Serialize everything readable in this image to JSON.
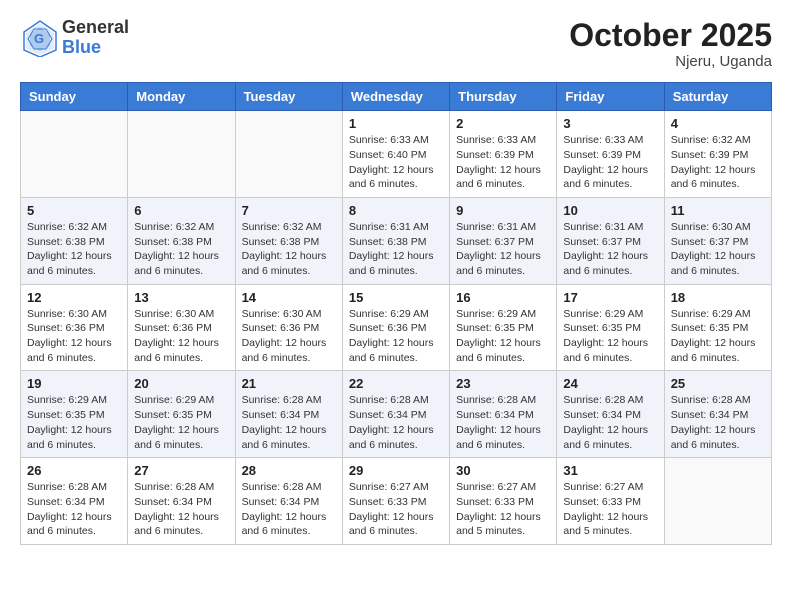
{
  "header": {
    "logo_general": "General",
    "logo_blue": "Blue",
    "month": "October 2025",
    "location": "Njeru, Uganda"
  },
  "days_of_week": [
    "Sunday",
    "Monday",
    "Tuesday",
    "Wednesday",
    "Thursday",
    "Friday",
    "Saturday"
  ],
  "weeks": [
    [
      {
        "day": "",
        "info": ""
      },
      {
        "day": "",
        "info": ""
      },
      {
        "day": "",
        "info": ""
      },
      {
        "day": "1",
        "info": "Sunrise: 6:33 AM\nSunset: 6:40 PM\nDaylight: 12 hours\nand 6 minutes."
      },
      {
        "day": "2",
        "info": "Sunrise: 6:33 AM\nSunset: 6:39 PM\nDaylight: 12 hours\nand 6 minutes."
      },
      {
        "day": "3",
        "info": "Sunrise: 6:33 AM\nSunset: 6:39 PM\nDaylight: 12 hours\nand 6 minutes."
      },
      {
        "day": "4",
        "info": "Sunrise: 6:32 AM\nSunset: 6:39 PM\nDaylight: 12 hours\nand 6 minutes."
      }
    ],
    [
      {
        "day": "5",
        "info": "Sunrise: 6:32 AM\nSunset: 6:38 PM\nDaylight: 12 hours\nand 6 minutes."
      },
      {
        "day": "6",
        "info": "Sunrise: 6:32 AM\nSunset: 6:38 PM\nDaylight: 12 hours\nand 6 minutes."
      },
      {
        "day": "7",
        "info": "Sunrise: 6:32 AM\nSunset: 6:38 PM\nDaylight: 12 hours\nand 6 minutes."
      },
      {
        "day": "8",
        "info": "Sunrise: 6:31 AM\nSunset: 6:38 PM\nDaylight: 12 hours\nand 6 minutes."
      },
      {
        "day": "9",
        "info": "Sunrise: 6:31 AM\nSunset: 6:37 PM\nDaylight: 12 hours\nand 6 minutes."
      },
      {
        "day": "10",
        "info": "Sunrise: 6:31 AM\nSunset: 6:37 PM\nDaylight: 12 hours\nand 6 minutes."
      },
      {
        "day": "11",
        "info": "Sunrise: 6:30 AM\nSunset: 6:37 PM\nDaylight: 12 hours\nand 6 minutes."
      }
    ],
    [
      {
        "day": "12",
        "info": "Sunrise: 6:30 AM\nSunset: 6:36 PM\nDaylight: 12 hours\nand 6 minutes."
      },
      {
        "day": "13",
        "info": "Sunrise: 6:30 AM\nSunset: 6:36 PM\nDaylight: 12 hours\nand 6 minutes."
      },
      {
        "day": "14",
        "info": "Sunrise: 6:30 AM\nSunset: 6:36 PM\nDaylight: 12 hours\nand 6 minutes."
      },
      {
        "day": "15",
        "info": "Sunrise: 6:29 AM\nSunset: 6:36 PM\nDaylight: 12 hours\nand 6 minutes."
      },
      {
        "day": "16",
        "info": "Sunrise: 6:29 AM\nSunset: 6:35 PM\nDaylight: 12 hours\nand 6 minutes."
      },
      {
        "day": "17",
        "info": "Sunrise: 6:29 AM\nSunset: 6:35 PM\nDaylight: 12 hours\nand 6 minutes."
      },
      {
        "day": "18",
        "info": "Sunrise: 6:29 AM\nSunset: 6:35 PM\nDaylight: 12 hours\nand 6 minutes."
      }
    ],
    [
      {
        "day": "19",
        "info": "Sunrise: 6:29 AM\nSunset: 6:35 PM\nDaylight: 12 hours\nand 6 minutes."
      },
      {
        "day": "20",
        "info": "Sunrise: 6:29 AM\nSunset: 6:35 PM\nDaylight: 12 hours\nand 6 minutes."
      },
      {
        "day": "21",
        "info": "Sunrise: 6:28 AM\nSunset: 6:34 PM\nDaylight: 12 hours\nand 6 minutes."
      },
      {
        "day": "22",
        "info": "Sunrise: 6:28 AM\nSunset: 6:34 PM\nDaylight: 12 hours\nand 6 minutes."
      },
      {
        "day": "23",
        "info": "Sunrise: 6:28 AM\nSunset: 6:34 PM\nDaylight: 12 hours\nand 6 minutes."
      },
      {
        "day": "24",
        "info": "Sunrise: 6:28 AM\nSunset: 6:34 PM\nDaylight: 12 hours\nand 6 minutes."
      },
      {
        "day": "25",
        "info": "Sunrise: 6:28 AM\nSunset: 6:34 PM\nDaylight: 12 hours\nand 6 minutes."
      }
    ],
    [
      {
        "day": "26",
        "info": "Sunrise: 6:28 AM\nSunset: 6:34 PM\nDaylight: 12 hours\nand 6 minutes."
      },
      {
        "day": "27",
        "info": "Sunrise: 6:28 AM\nSunset: 6:34 PM\nDaylight: 12 hours\nand 6 minutes."
      },
      {
        "day": "28",
        "info": "Sunrise: 6:28 AM\nSunset: 6:34 PM\nDaylight: 12 hours\nand 6 minutes."
      },
      {
        "day": "29",
        "info": "Sunrise: 6:27 AM\nSunset: 6:33 PM\nDaylight: 12 hours\nand 6 minutes."
      },
      {
        "day": "30",
        "info": "Sunrise: 6:27 AM\nSunset: 6:33 PM\nDaylight: 12 hours\nand 5 minutes."
      },
      {
        "day": "31",
        "info": "Sunrise: 6:27 AM\nSunset: 6:33 PM\nDaylight: 12 hours\nand 5 minutes."
      },
      {
        "day": "",
        "info": ""
      }
    ]
  ]
}
